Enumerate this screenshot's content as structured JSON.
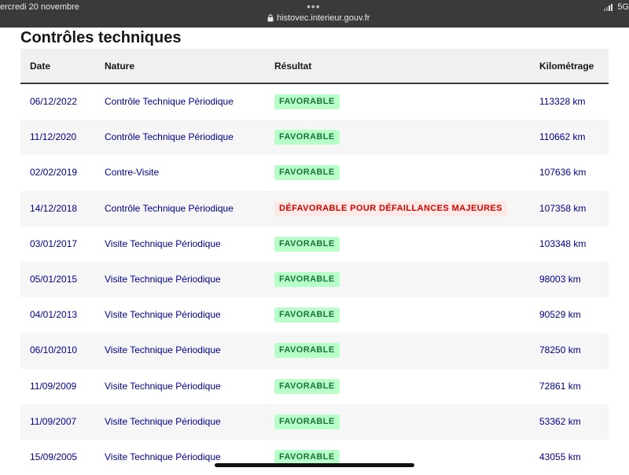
{
  "status_bar": {
    "date": "ercredi 20 novembre",
    "dots": "•••",
    "url": "histovec.interieur.gouv.fr",
    "network": "5G"
  },
  "page": {
    "title": "Contrôles techniques"
  },
  "table": {
    "headers": {
      "date": "Date",
      "nature": "Nature",
      "result": "Résultat",
      "km": "Kilométrage"
    },
    "rows": [
      {
        "date": "06/12/2022",
        "nature": "Contrôle Technique Périodique",
        "result": "FAVORABLE",
        "status": "ok",
        "km": "113328 km"
      },
      {
        "date": "11/12/2020",
        "nature": "Contrôle Technique Périodique",
        "result": "FAVORABLE",
        "status": "ok",
        "km": "110662 km"
      },
      {
        "date": "02/02/2019",
        "nature": "Contre-Visite",
        "result": "FAVORABLE",
        "status": "ok",
        "km": "107636 km"
      },
      {
        "date": "14/12/2018",
        "nature": "Contrôle Technique Périodique",
        "result": "DÉFAVORABLE POUR DÉFAILLANCES MAJEURES",
        "status": "ko",
        "km": "107358 km"
      },
      {
        "date": "03/01/2017",
        "nature": "Visite Technique Périodique",
        "result": "FAVORABLE",
        "status": "ok",
        "km": "103348 km"
      },
      {
        "date": "05/01/2015",
        "nature": "Visite Technique Périodique",
        "result": "FAVORABLE",
        "status": "ok",
        "km": "98003 km"
      },
      {
        "date": "04/01/2013",
        "nature": "Visite Technique Périodique",
        "result": "FAVORABLE",
        "status": "ok",
        "km": "90529 km"
      },
      {
        "date": "06/10/2010",
        "nature": "Visite Technique Périodique",
        "result": "FAVORABLE",
        "status": "ok",
        "km": "78250 km"
      },
      {
        "date": "11/09/2009",
        "nature": "Visite Technique Périodique",
        "result": "FAVORABLE",
        "status": "ok",
        "km": "72861 km"
      },
      {
        "date": "11/09/2007",
        "nature": "Visite Technique Périodique",
        "result": "FAVORABLE",
        "status": "ok",
        "km": "53362 km"
      },
      {
        "date": "15/09/2005",
        "nature": "Visite Technique Périodique",
        "result": "FAVORABLE",
        "status": "ok",
        "km": "43055 km"
      }
    ]
  },
  "colors": {
    "favorable_bg": "#b8fec9",
    "favorable_text": "#18753c",
    "defavorable_bg": "#ffe9e6",
    "defavorable_text": "#ce0500",
    "link_blue": "#000091"
  }
}
